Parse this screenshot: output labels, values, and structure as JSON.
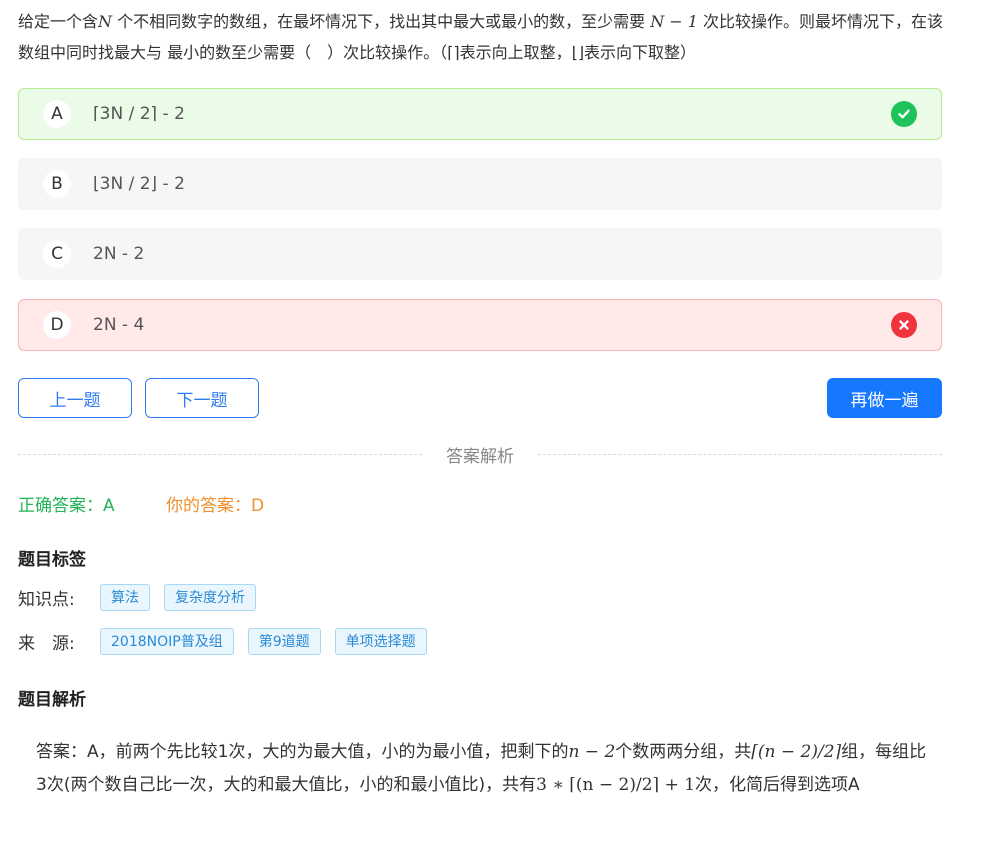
{
  "question": {
    "text_a": "给定一个含",
    "var_n": "N",
    "text_b": " 个不相同数字的数组，在最坏情况下，找出其中最大或最小的数，至少需要 ",
    "formula_n1": "N − 1",
    "text_c": " 次比较操作。则最坏情况下，在该数组中同时找最大与 最小的数至少需要（　）次比较操作。（⌈⌉表示向上取整，⌊⌋表示向下取整）"
  },
  "options": [
    {
      "letter": "A",
      "text": "⌈3N / 2⌉ - 2",
      "status": "correct"
    },
    {
      "letter": "B",
      "text": "⌊3N / 2⌋ - 2",
      "status": "none"
    },
    {
      "letter": "C",
      "text": "2N - 2",
      "status": "none"
    },
    {
      "letter": "D",
      "text": "2N - 4",
      "status": "wrong"
    }
  ],
  "buttons": {
    "prev": "上一题",
    "next": "下一题",
    "redo": "再做一遍"
  },
  "divider_label": "答案解析",
  "result": {
    "correct_label": "正确答案：",
    "correct_value": "A",
    "yours_label": "你的答案：",
    "yours_value": "D"
  },
  "tags_section": {
    "title": "题目标签",
    "knowledge_label": "知识点:",
    "knowledge": [
      "算法",
      "复杂度分析"
    ],
    "source_label": "来　源:",
    "source": [
      "2018NOIP普及组",
      "第9道题",
      "单项选择题"
    ]
  },
  "analysis": {
    "title": "题目解析",
    "p1": "答案：A，前两个先比较1次，大的为最大值，小的为最小值，把剩下的",
    "f1": "n − 2",
    "p2": "个数两两分组，共",
    "f2": "⌈(n − 2)/2⌉",
    "p3": "组，每组比3次(两个数自己比一次，大的和最大值比，小的和最小值比)，共有",
    "f3": "3 ∗ ⌈(n − 2)/2⌉ + 1",
    "p4": "次，化简后得到选项A"
  },
  "colors": {
    "correct": "#1ec25a",
    "wrong": "#f0343e",
    "primary": "#1677ff",
    "tag_text": "#2b8ad6",
    "yours": "#f0902e"
  }
}
